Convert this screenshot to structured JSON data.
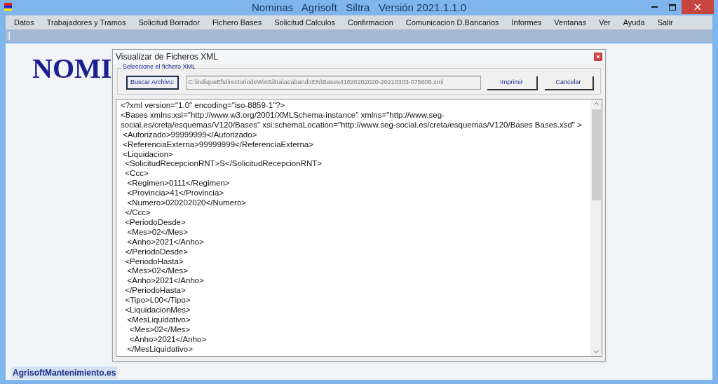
{
  "window": {
    "title": "Nominas   Agrisoft   Siltra   Versión 2021.1.1.0"
  },
  "menu": [
    "Datos",
    "Trabajadores y Tramos",
    "Solicitud Borrador",
    "Fichero Bases",
    "Solicitud Calculos",
    "Confirmacion",
    "Comunicacion D.Bancarios",
    "Informes",
    "Ventanas",
    "Ver",
    "Ayuda",
    "Salir"
  ],
  "background_logo": "NOMI",
  "dialog": {
    "title": "Visualizar de Ficheros XML",
    "group_label": "Seleccione el fichero XML",
    "browse_button": "Buscar Archivo:",
    "file_path": "C:\\indiqueEl\\directoriodeWinSiltra\\acabandoEN\\Bases41020202020-20210303-075606.xml",
    "print_button": "Imprimir",
    "cancel_button": "Cancelar",
    "xml_lines": [
      "<?xml version=\"1.0\" encoding=\"iso-8859-1\"?>",
      "<Bases xmlns:xsi=\"http://www.w3.org/2001/XMLSchema-instance\" xmlns=\"http://www.seg-",
      "social.es/creta/esquemas/V120/Bases\" xsi:schemaLocation=\"http://www.seg-social.es/creta/esquemas/V120/Bases Bases.xsd\" >",
      " <Autorizado>99999999</Autorizado>",
      " <ReferenciaExterna>99999999</ReferenciaExterna>",
      " <Liquidacion>",
      "  <SolicitudRecepcionRNT>S</SolicitudRecepcionRNT>",
      "  <Ccc>",
      "   <Regimen>0111</Regimen>",
      "   <Provincia>41</Provincia>",
      "   <Numero>020202020</Numero>",
      "  </Ccc>",
      "  <PeriodoDesde>",
      "   <Mes>02</Mes>",
      "   <Anho>2021</Anho>",
      "  </PeriodoDesde>",
      "  <PeriodoHasta>",
      "   <Mes>02</Mes>",
      "   <Anho>2021</Anho>",
      "  </PeriodoHasta>",
      "  <Tipo>L00</Tipo>",
      "  <LiquidacionMes>",
      "   <MesLiquidativo>",
      "    <Mes>02</Mes>",
      "    <Anho>2021</Anho>",
      "   </MesLiquidativo>"
    ]
  },
  "status_bar": "AgrisoftMantenimiento.es"
}
